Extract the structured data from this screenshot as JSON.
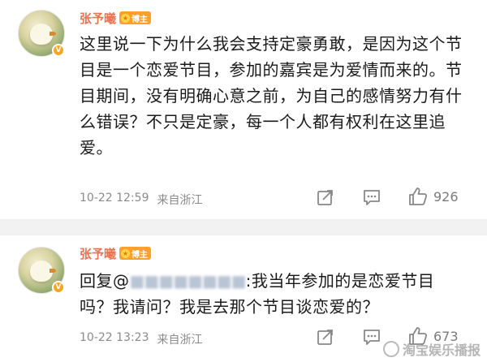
{
  "comments": [
    {
      "username": "张予曦",
      "tag": "博主",
      "text": "这里说一下为什么我会支持定豪勇敢，是因为这个节目是一个恋爱节目，参加的嘉宾是为爱情而来的。节目期间，没有明确心意之前，为自己的感情努力有什么错误？不只是定豪，每一个人都有权利在这里追爱。",
      "date": "10-22 12:59",
      "source": "来自浙江",
      "likes": "926"
    },
    {
      "username": "张予曦",
      "tag": "博主",
      "reply_prefix": "回复@",
      "reply_mention": "■■■■■■■■",
      "reply_suffix": ":我当年参加的是恋爱节目",
      "reply_line2": "吗？我请问？我是去那个节目谈恋爱的？",
      "date": "10-22 13:23",
      "source": "来自浙江",
      "likes": "673"
    }
  ],
  "watermark": "淘宝娱乐播报",
  "icons": {
    "share": "share-icon",
    "comment": "comment-icon",
    "like": "thumbs-up-icon",
    "verified": "verified-v-icon"
  },
  "colors": {
    "username": "#eb7350",
    "tag": "#ff9f2e",
    "verified": "#f5a623"
  }
}
